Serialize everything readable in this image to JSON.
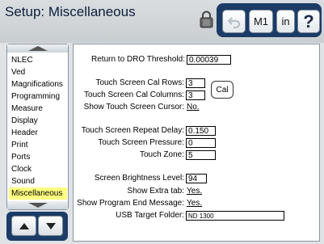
{
  "header": {
    "title": "Setup: Miscellaneous",
    "buttons": {
      "m1": "M1",
      "units": "in",
      "help": "?"
    }
  },
  "sidebar": {
    "items": [
      {
        "label": "NLEC"
      },
      {
        "label": "Ved"
      },
      {
        "label": "Magnifications"
      },
      {
        "label": "Programming"
      },
      {
        "label": "Measure"
      },
      {
        "label": "Display"
      },
      {
        "label": "Header"
      },
      {
        "label": "Print"
      },
      {
        "label": "Ports"
      },
      {
        "label": "Clock"
      },
      {
        "label": "Sound"
      },
      {
        "label": "Miscellaneous",
        "selected": true
      }
    ]
  },
  "settings": {
    "return_threshold": {
      "label": "Return to DRO Threshold:",
      "value": "0.00039"
    },
    "cal_rows": {
      "label": "Touch Screen Cal Rows:",
      "value": "3"
    },
    "cal_columns": {
      "label": "Touch Screen Cal Columns:",
      "value": "3"
    },
    "show_cursor": {
      "label": "Show Touch Screen Cursor:",
      "value": "No."
    },
    "cal_button": "Cal",
    "repeat_delay": {
      "label": "Touch Screen Repeat Delay:",
      "value": "0.150"
    },
    "pressure": {
      "label": "Touch Screen Pressure:",
      "value": "0"
    },
    "touch_zone": {
      "label": "Touch Zone:",
      "value": "5"
    },
    "brightness": {
      "label": "Screen Brightness Level:",
      "value": "94"
    },
    "extra_tab": {
      "label": "Show Extra tab:",
      "value": "Yes."
    },
    "program_end": {
      "label": "Show Program End Message:",
      "value": "Yes."
    },
    "usb_folder": {
      "label": "USB Target Folder:",
      "value": "ND 1300"
    }
  },
  "colors": {
    "accent": "#1c3b66",
    "selected": "#ffff80",
    "title": "#0c1f3a"
  },
  "icons": [
    "lock-icon",
    "undo-icon",
    "up-arrow-icon",
    "down-arrow-icon"
  ]
}
